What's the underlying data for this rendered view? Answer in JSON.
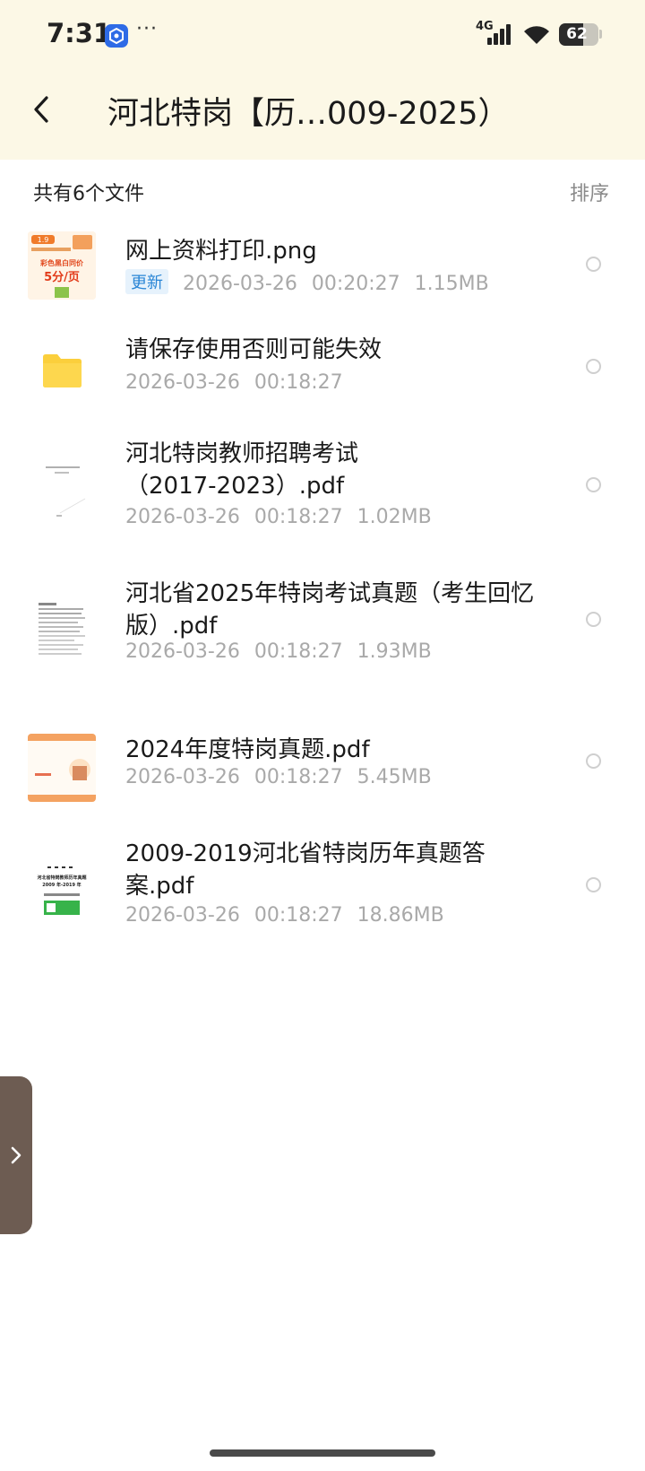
{
  "status_bar": {
    "time": "7:31",
    "more": "···",
    "network": "4G",
    "battery_level": "62",
    "battery_percent": 62
  },
  "header": {
    "title": "河北特岗【历…009-2025）"
  },
  "toolbar": {
    "summary": "共有6个文件",
    "sort_label": "排序"
  },
  "files": [
    {
      "name": "网上资料打印.png",
      "tag": "更新",
      "date": "2026-03-26",
      "time": "00:20:27",
      "size": "1.15MB",
      "type": "image"
    },
    {
      "name": "请保存使用否则可能失效",
      "date": "2026-03-26",
      "time": "00:18:27",
      "size": "",
      "type": "folder"
    },
    {
      "name": "河北特岗教师招聘考试（2017-2023）.pdf",
      "date": "2026-03-26",
      "time": "00:18:27",
      "size": "1.02MB",
      "type": "pdf"
    },
    {
      "name": "河北省2025年特岗考试真题（考生回忆版）.pdf",
      "date": "2026-03-26",
      "time": "00:18:27",
      "size": "1.93MB",
      "type": "pdf"
    },
    {
      "name": "2024年度特岗真题.pdf",
      "date": "2026-03-26",
      "time": "00:18:27",
      "size": "5.45MB",
      "type": "pdf"
    },
    {
      "name": "2009-2019河北省特岗历年真题答案.pdf",
      "date": "2026-03-26",
      "time": "00:18:27",
      "size": "18.86MB",
      "type": "pdf"
    }
  ],
  "thumb_text": {
    "promo_price": "5分/页",
    "promo_line": "彩色黑白同价",
    "promo_badge": "1.9",
    "cover_title": "河北省特岗教师历年真题",
    "cover_years": "2009 年-2019 年"
  },
  "colors": {
    "header_bg": "#fcf8e6",
    "folder": "#fbcf3c",
    "update_tag_bg": "#e6f2fc",
    "update_tag_text": "#2a86d6",
    "side_tab": "#6d5c52"
  }
}
